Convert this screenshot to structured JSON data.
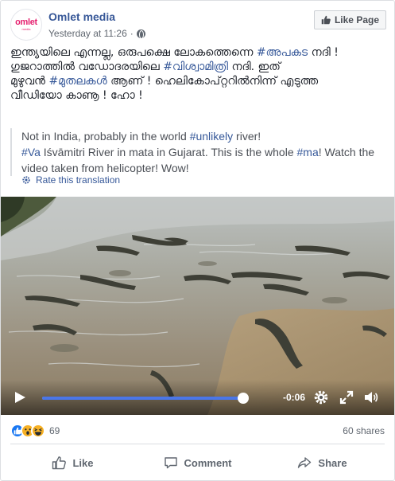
{
  "header": {
    "avatar_text": "omlet",
    "avatar_sub": "media",
    "page_name": "Omlet media",
    "timestamp": "Yesterday at 11:26",
    "separator": "·",
    "like_page_label": "Like Page"
  },
  "post": {
    "line1_a": "ഇന്ത്യയിലെ എന്നല്ല, ഒരുപക്ഷെ ലോകത്തെന്നെ ",
    "line1_tag": "#അപകട",
    "line1_b": " നദി !",
    "line2_a": "ഗുജറാത്തിൽ വഡോദരയിലെ ",
    "line2_tag": "#വിശ്വാമിത്രി",
    "line2_b": " നദി. ഇത്",
    "line3_a": "മുഴുവൻ ",
    "line3_tag": "#മുതലകൾ",
    "line3_b": " ആണ് ! ഹെലികോപ്റ്ററിൽനിന്ന് എടുത്ത",
    "line4": "വീഡിയോ കാണൂ ! ഹോ !"
  },
  "translation": {
    "t1_a": "Not in India, probably in the world ",
    "t1_tag": "#unlikely",
    "t1_b": " river!",
    "t2_tag1": "#Va",
    "t2_a": " Iśvāmitri River in mata in Gujarat. This is the whole ",
    "t2_tag2": "#ma",
    "t2_b": "! Watch the",
    "t3": "video taken from helicopter! Wow!",
    "rate_label": "Rate this translation"
  },
  "video": {
    "progress": 0.98,
    "time_remaining": "-0:06"
  },
  "stats": {
    "reaction_count": "69",
    "shares": "60 shares"
  },
  "actions": {
    "like": "Like",
    "comment": "Comment",
    "share": "Share"
  },
  "colors": {
    "link": "#385898",
    "accent_blue": "#4a76e8",
    "brand_pink": "#e5206f"
  }
}
